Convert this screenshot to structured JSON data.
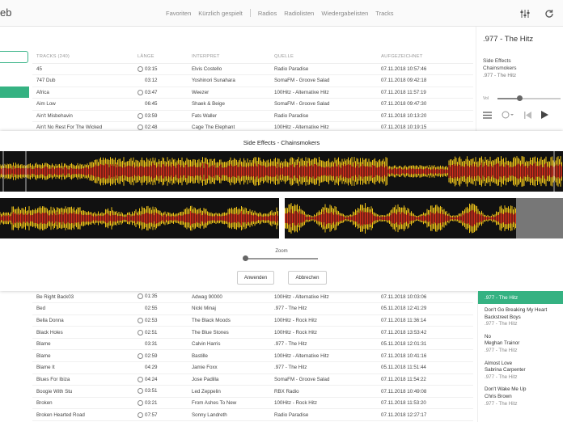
{
  "brand": "eb",
  "nav": {
    "items": [
      "Favoriten",
      "Kürzlich gespielt",
      "Radios",
      "Radiolisten",
      "Wiedergabelisten",
      "Tracks"
    ]
  },
  "top_table": {
    "headers": [
      "TRACKS (240)",
      "LÄNGE",
      "INTERPRET",
      "QUELLE",
      "AUFGEZEICHNET"
    ],
    "rows": [
      {
        "track": "45",
        "fav": true,
        "len": "03:15",
        "artist": "Elvis Costello",
        "source": "Radio Paradise",
        "date": "07.11.2018 10:57:46"
      },
      {
        "track": "747 Dub",
        "fav": false,
        "len": "03:12",
        "artist": "Yoshinori Sunahara",
        "source": "SomaFM - Groove Salad",
        "date": "07.11.2018 09:42:18"
      },
      {
        "track": "Africa",
        "fav": true,
        "len": "03:47",
        "artist": "Weezer",
        "source": "100Hitz - Alternative Hitz",
        "date": "07.11.2018 11:57:19"
      },
      {
        "track": "Aim Low",
        "fav": false,
        "len": "06:45",
        "artist": "Shaek & Beige",
        "source": "SomaFM - Groove Salad",
        "date": "07.11.2018 09:47:30"
      },
      {
        "track": "Ain't Misbehavin",
        "fav": true,
        "len": "03:59",
        "artist": "Fats Waller",
        "source": "Radio Paradise",
        "date": "07.11.2018 10:13:20"
      },
      {
        "track": "Ain't No Rest For The Wicked",
        "fav": true,
        "len": "02:48",
        "artist": "Cage The Elephant",
        "source": "100Hitz - Alternative Hitz",
        "date": "07.11.2018 10:19:15"
      }
    ]
  },
  "now_playing": {
    "title": ".977 - The Hitz",
    "track": "Side Effects",
    "artist": "Chainsmokers",
    "station": ".977 - The Hitz",
    "volume_label": "Vol",
    "volume_fraction": 0.35
  },
  "editor": {
    "title": "Side Effects - Chainsmokers",
    "zoom_label": "Zoom",
    "zoom_fraction": 0.0,
    "apply_label": "Anwenden",
    "cancel_label": "Abbrechen"
  },
  "bottom_table": {
    "rows": [
      {
        "track": "Be Right Back03",
        "fav": true,
        "len": "01:35",
        "artist": "Adwag 90000",
        "source": "100Hitz - Alternative Hitz",
        "date": "07.11.2018 10:03:06"
      },
      {
        "track": "Bed",
        "fav": false,
        "len": "02:55",
        "artist": "Nicki Minaj",
        "source": ".977 - The Hitz",
        "date": "05.11.2018 12:41:29"
      },
      {
        "track": "Bella Donna",
        "fav": true,
        "len": "02:53",
        "artist": "The Black Moods",
        "source": "100Hitz - Rock Hitz",
        "date": "07.11.2018 11:36:14"
      },
      {
        "track": "Black Holes",
        "fav": true,
        "len": "02:51",
        "artist": "The Blue Stones",
        "source": "100Hitz - Rock Hitz",
        "date": "07.11.2018 13:53:42"
      },
      {
        "track": "Blame",
        "fav": false,
        "len": "03:31",
        "artist": "Calvin Harris",
        "source": ".977 - The Hitz",
        "date": "05.11.2018 12:01:31"
      },
      {
        "track": "Blame",
        "fav": true,
        "len": "02:59",
        "artist": "Bastille",
        "source": "100Hitz - Alternative Hitz",
        "date": "07.11.2018 10:41:16"
      },
      {
        "track": "Blame It",
        "fav": false,
        "len": "04:29",
        "artist": "Jamie Foxx",
        "source": ".977 - The Hitz",
        "date": "05.11.2018 11:51:44"
      },
      {
        "track": "Blues For Ibiza",
        "fav": true,
        "len": "04:24",
        "artist": "Jose Padilla",
        "source": "SomaFM - Groove Salad",
        "date": "07.11.2018 11:54:22"
      },
      {
        "track": "Boogie With Stu",
        "fav": true,
        "len": "03:51",
        "artist": "Led Zeppelin",
        "source": "RBX Radio",
        "date": "07.11.2018 10:49:08"
      },
      {
        "track": "Broken",
        "fav": true,
        "len": "03:21",
        "artist": "From Ashes To New",
        "source": "100Hitz - Rock Hitz",
        "date": "07.11.2018 11:53:20"
      },
      {
        "track": "Broken Hearted Road",
        "fav": true,
        "len": "07:57",
        "artist": "Sonny Landreth",
        "source": "Radio Paradise",
        "date": "07.11.2018 12:27:17"
      }
    ]
  },
  "queue": {
    "active": ".977 - The Hitz",
    "items": [
      {
        "title": "Don't Go Breaking My Heart",
        "artist": "Backstreet Boys",
        "station": ".977 - The Hitz"
      },
      {
        "title": "No",
        "artist": "Meghan Trainor",
        "station": ".977 - The Hitz"
      },
      {
        "title": "Almost Love",
        "artist": "Sabrina Carpenter",
        "station": ".977 - The Hitz"
      },
      {
        "title": "Don't Wake Me Up",
        "artist": "Chris Brown",
        "station": ".977 - The Hitz"
      }
    ]
  },
  "colors": {
    "accent": "#35b282",
    "wave_red": "#d9301b",
    "wave_yellow": "#f0c419"
  }
}
